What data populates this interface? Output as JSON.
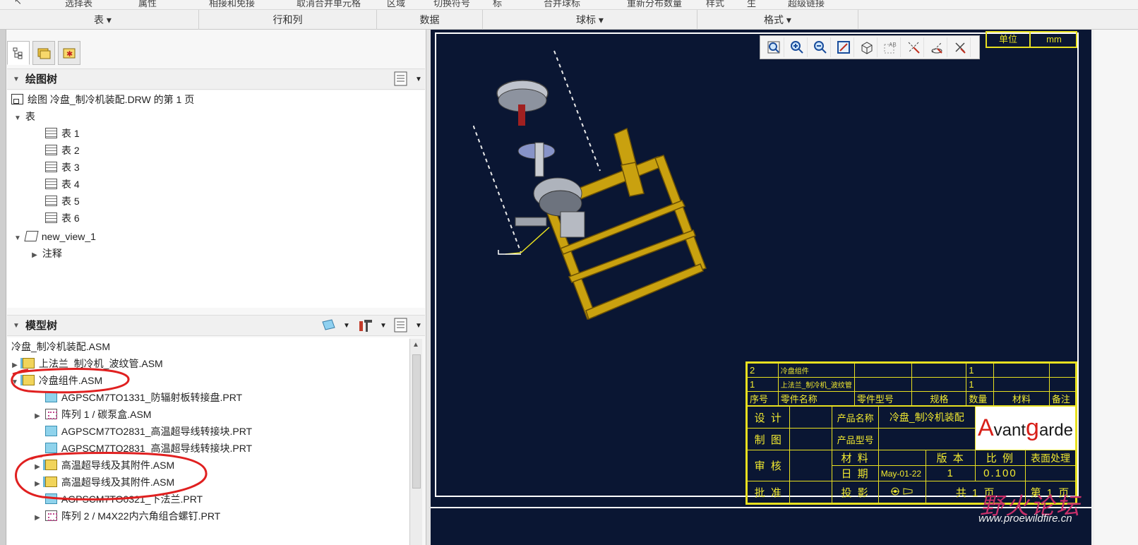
{
  "ribbon_top": [
    "选择表",
    "属性",
    "相接和免接",
    "取消合并单元格",
    "区域",
    "切换符号",
    "标",
    "合并球标",
    "重新分布数量",
    "样式",
    "生",
    "超级链接"
  ],
  "groupbar": {
    "groups": [
      "表",
      "行和列",
      "数据",
      "球标",
      "格式"
    ]
  },
  "drawing_tree": {
    "title": "绘图树",
    "root": "绘图 冷盘_制冷机装配.DRW 的第 1 页",
    "tables_node": "表",
    "tables": [
      "表 1",
      "表 2",
      "表 3",
      "表 4",
      "表 5",
      "表 6"
    ],
    "view": "new_view_1",
    "notes": "注释"
  },
  "model_tree": {
    "title": "模型树",
    "root": "冷盘_制冷机装配.ASM",
    "items": [
      {
        "label": "上法兰_制冷机_波纹管.ASM",
        "type": "asm",
        "arrow": "▶",
        "indent": 0
      },
      {
        "label": "冷盘组件.ASM",
        "type": "asm",
        "arrow": "▼",
        "indent": 0
      },
      {
        "label": "AGPSCM7TO1331_防辐射板转接盘.PRT",
        "type": "prt",
        "arrow": "",
        "indent": 1
      },
      {
        "label": "阵列 1 / 碳泵盒.ASM",
        "type": "pat",
        "arrow": "▶",
        "indent": 1
      },
      {
        "label": "AGPSCM7TO2831_高温超导线转接块.PRT",
        "type": "prt",
        "arrow": "",
        "indent": 1
      },
      {
        "label": "AGPSCM7TO2831_高温超导线转接块.PRT",
        "type": "prt",
        "arrow": "",
        "indent": 1
      },
      {
        "label": "高温超导线及其附件.ASM",
        "type": "asm",
        "arrow": "▶",
        "indent": 1
      },
      {
        "label": "高温超导线及其附件.ASM",
        "type": "asm",
        "arrow": "▶",
        "indent": 1
      },
      {
        "label": "AGPSCM7TO0321_下法兰.PRT",
        "type": "prt",
        "arrow": "",
        "indent": 1
      },
      {
        "label": "阵列 2 / M4X22内六角组合螺钉.PRT",
        "type": "pat",
        "arrow": "▶",
        "indent": 1
      }
    ]
  },
  "view_toolbar": [
    "zoom-window-icon",
    "zoom-in-icon",
    "zoom-out-icon",
    "refit-icon",
    "shade-icon",
    "note-display-icon",
    "datum-display-icon",
    "axis-display-icon",
    "point-display-icon"
  ],
  "unit": {
    "label": "单位",
    "value": "mm"
  },
  "title_block": {
    "bom_rows": [
      {
        "no": "2",
        "name": "冷盘组件",
        "qty": "1"
      },
      {
        "no": "1",
        "name": "上法兰_制冷机_波纹管",
        "qty": "1"
      }
    ],
    "headers": [
      "序号",
      "零件名称",
      "零件型号",
      "规格",
      "数量",
      "材料",
      "备注"
    ],
    "design": "设 计",
    "draw": "制 图",
    "check": "审 核",
    "approve": "批 准",
    "product_name_label": "产品名称",
    "product_name": "冷盘_制冷机装配",
    "product_model_label": "产品型号",
    "material_label": "材 料",
    "version_label": "版 本",
    "scale_label": "比 例",
    "surface_label": "表面处理",
    "date_label": "日 期",
    "date_value": "May-01-22",
    "version_value": "1",
    "scale_value": "0.100",
    "projection_label": "投 影",
    "total_pages": "共 1 页",
    "page_no": "第 1 页",
    "logo": {
      "A": "A",
      "mid1": "vant",
      "g": "g",
      "mid2": "arde"
    }
  },
  "watermark": {
    "text": "野火论坛",
    "url": "www.proewildfire.cn"
  },
  "colors": {
    "canvas": "#0a1633",
    "frame": "#ffffff",
    "title_block": "#e8e020",
    "model_frame": "#c9a10f",
    "annotation": "#e02020"
  }
}
